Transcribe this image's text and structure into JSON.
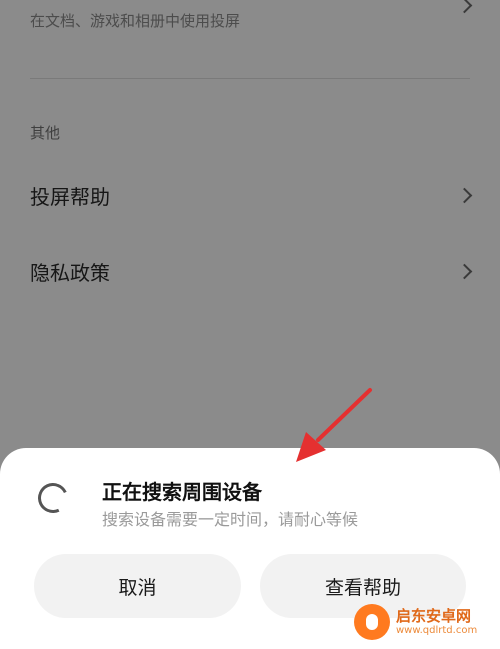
{
  "settings": {
    "top_item": {
      "subtitle": "在文档、游戏和相册中使用投屏"
    },
    "section_label": "其他",
    "items": [
      {
        "label": "投屏帮助"
      },
      {
        "label": "隐私政策"
      }
    ]
  },
  "dialog": {
    "title": "正在搜索周围设备",
    "description": "搜索设备需要一定时间，请耐心等候",
    "cancel_label": "取消",
    "help_label": "查看帮助"
  },
  "watermark": {
    "name": "启东安卓网",
    "url": "www.qdlrtd.com"
  },
  "colors": {
    "annotation_arrow": "#e53030",
    "watermark_orange": "#ff7a1f"
  }
}
